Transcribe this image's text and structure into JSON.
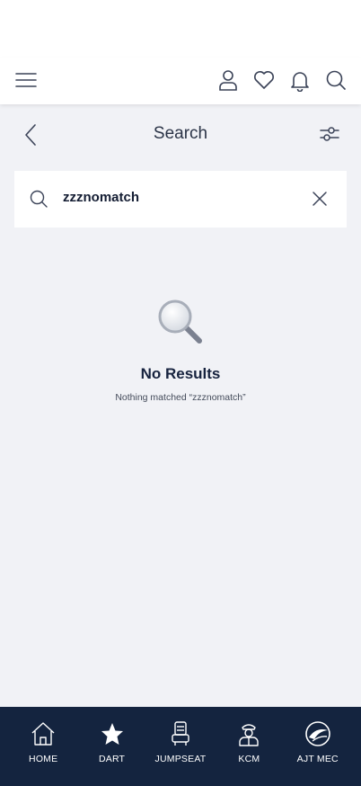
{
  "topbar": {
    "icons": [
      "menu-icon",
      "profile-icon",
      "heart-icon",
      "bell-icon",
      "search-icon"
    ]
  },
  "search_header": {
    "title": "Search",
    "back_icon": "chevron-left-icon",
    "filter_icon": "filter-sliders-icon"
  },
  "search_box": {
    "query": "zzznomatch",
    "icon": "search-icon",
    "clear_icon": "close-icon"
  },
  "empty_state": {
    "icon": "magnifier-icon",
    "headline": "No Results",
    "message": "Nothing matched “zzznomatch”"
  },
  "tabbar": {
    "tabs": [
      {
        "label": "HOME",
        "icon": "home-icon"
      },
      {
        "label": "DART",
        "icon": "star-icon"
      },
      {
        "label": "JUMPSEAT",
        "icon": "seat-icon"
      },
      {
        "label": "KCM",
        "icon": "pilot-icon"
      },
      {
        "label": "AJT MEC",
        "icon": "ajt-logo-icon"
      }
    ]
  },
  "colors": {
    "background": "#f1f2f6",
    "navy": "#14243f",
    "text": "#17233f"
  }
}
